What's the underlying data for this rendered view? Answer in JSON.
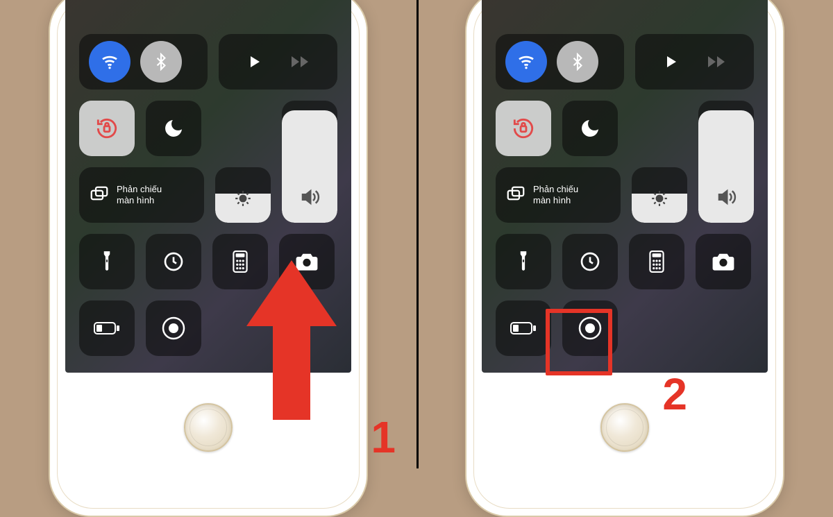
{
  "steps": {
    "one": "1",
    "two": "2"
  },
  "control_center": {
    "mirror_label_line1": "Phản chiếu",
    "mirror_label_line2": "màn hình"
  },
  "sliders": {
    "volume_fill_pct": 92,
    "brightness_fill_pct": 52
  },
  "icons": {
    "wifi": "wifi-icon",
    "bluetooth": "bluetooth-icon",
    "play": "play-icon",
    "forward": "forward-icon",
    "rotation_lock": "rotation-lock-icon",
    "dnd_moon": "moon-icon",
    "volume": "volume-icon",
    "screen_mirror": "screen-mirror-icon",
    "brightness": "brightness-icon",
    "flashlight": "flashlight-icon",
    "timer": "timer-icon",
    "calculator": "calculator-icon",
    "camera": "camera-icon",
    "low_power": "low-power-icon",
    "screen_record": "screen-record-icon"
  },
  "colors": {
    "annotation_red": "#e53427",
    "wifi_blue": "#2f6fe8"
  }
}
